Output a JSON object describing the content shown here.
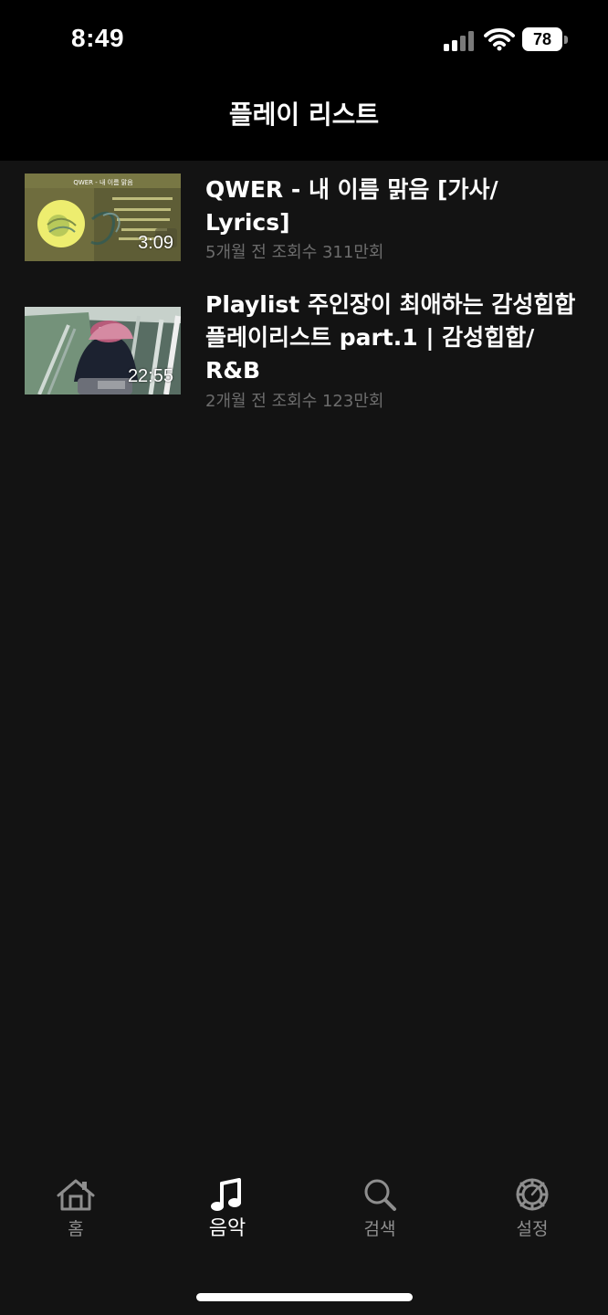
{
  "status_bar": {
    "time": "8:49",
    "battery": "78",
    "icons": [
      "signal-icon",
      "wifi-icon",
      "battery-icon"
    ]
  },
  "header": {
    "title": "플레이 리스트"
  },
  "playlist": {
    "items": [
      {
        "title": "QWER - 내 이름 맑음 [가사/ Lyrics]",
        "duration": "3:09",
        "meta": "5개월 전 조회수 311만회",
        "thumbnail": {
          "caption": "QWER - 내 이름 맑음",
          "alt": "QWER 내 이름 맑음 가사 영상 썸네일"
        }
      },
      {
        "title": "Playlist 주인장이 최애하는 감성힙합 플레이리스트 part.1 | 감성힙합/ R&B",
        "duration": "22:55",
        "meta": "2개월 전 조회수 123만회",
        "thumbnail": {
          "alt": "에스컬레이터 위 분홍 모자를 쓴 사람 썸네일"
        }
      }
    ]
  },
  "tabbar": {
    "tabs": [
      {
        "label": "홈",
        "icon": "home-icon",
        "active": false
      },
      {
        "label": "음악",
        "icon": "music-note-icon",
        "active": true
      },
      {
        "label": "검색",
        "icon": "search-icon",
        "active": false
      },
      {
        "label": "설정",
        "icon": "gear-icon",
        "active": false
      }
    ]
  },
  "colors": {
    "background": "#131313",
    "header_background": "#000000",
    "text_primary": "#ffffff",
    "text_secondary": "#6c6c6c",
    "tab_inactive": "#8e8e8e"
  }
}
